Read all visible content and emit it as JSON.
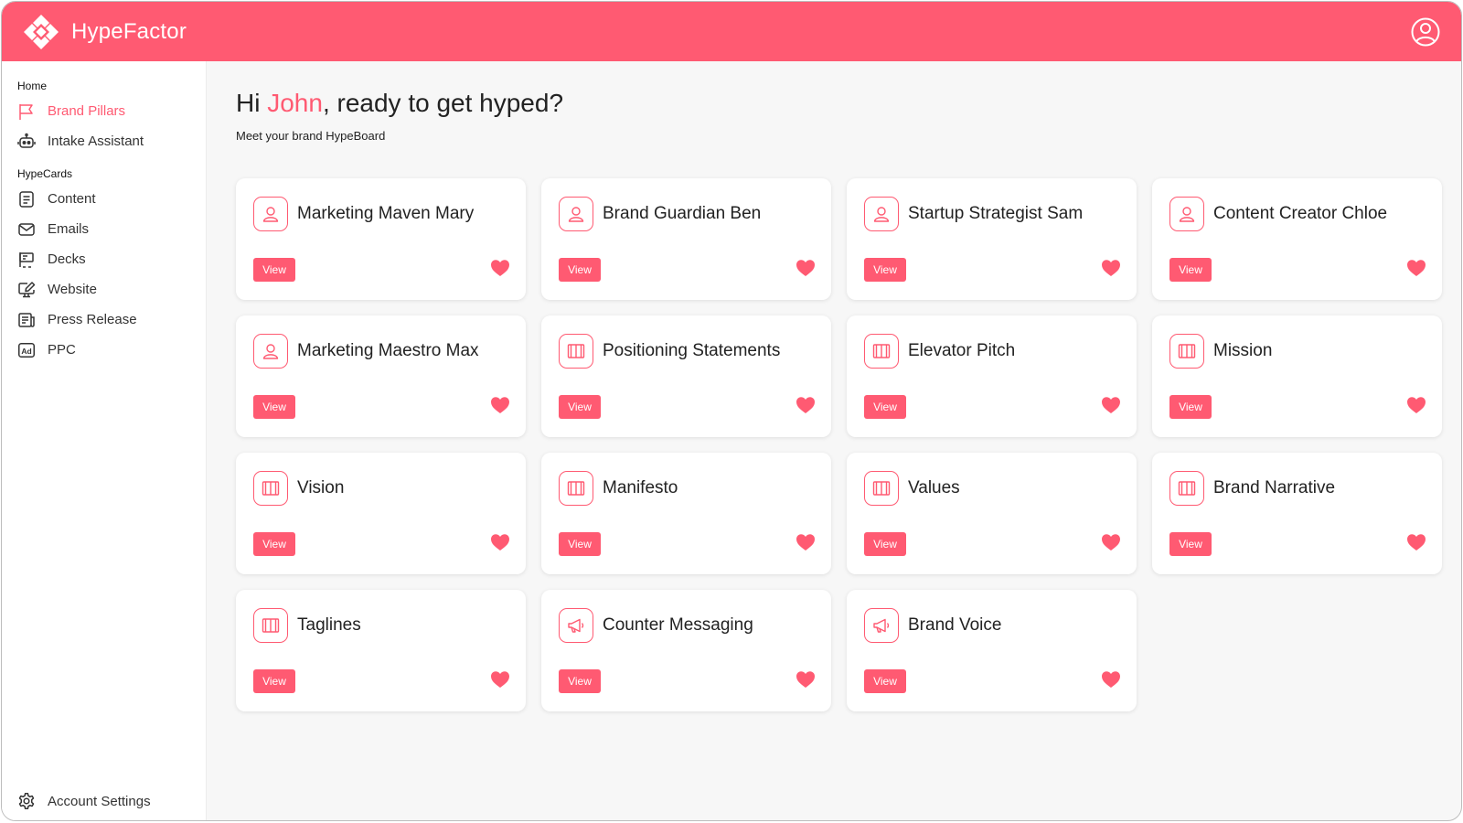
{
  "app": {
    "name": "HypeFactor"
  },
  "colors": {
    "accent": "#ff5a72",
    "background": "#f7f7f7",
    "card": "#ffffff"
  },
  "sidebar": {
    "home_section": "Home",
    "home_items": [
      {
        "label": "Brand Pillars",
        "icon": "flag-icon",
        "active": true
      },
      {
        "label": "Intake Assistant",
        "icon": "robot-icon",
        "active": false
      }
    ],
    "hypecards_section": "HypeCards",
    "hypecard_items": [
      {
        "label": "Content",
        "icon": "document-icon"
      },
      {
        "label": "Emails",
        "icon": "envelope-icon"
      },
      {
        "label": "Decks",
        "icon": "presentation-icon"
      },
      {
        "label": "Website",
        "icon": "monitor-edit-icon"
      },
      {
        "label": "Press Release",
        "icon": "newspaper-icon"
      },
      {
        "label": "PPC",
        "icon": "ad-icon"
      }
    ],
    "account_settings": "Account Settings"
  },
  "main": {
    "greeting_prefix": "Hi ",
    "user_name": "John",
    "greeting_suffix": ", ready to get hyped?",
    "subtitle": "Meet your brand HypeBoard"
  },
  "cards": [
    {
      "title": "Marketing Maven Mary",
      "icon": "user-icon",
      "button": "View"
    },
    {
      "title": "Brand Guardian Ben",
      "icon": "user-icon",
      "button": "View"
    },
    {
      "title": "Startup Strategist Sam",
      "icon": "user-icon",
      "button": "View"
    },
    {
      "title": "Content Creator Chloe",
      "icon": "user-icon",
      "button": "View"
    },
    {
      "title": "Marketing Maestro Max",
      "icon": "user-icon",
      "button": "View"
    },
    {
      "title": "Positioning Statements",
      "icon": "book-icon",
      "button": "View"
    },
    {
      "title": "Elevator Pitch",
      "icon": "book-icon",
      "button": "View"
    },
    {
      "title": "Mission",
      "icon": "book-icon",
      "button": "View"
    },
    {
      "title": "Vision",
      "icon": "book-icon",
      "button": "View"
    },
    {
      "title": "Manifesto",
      "icon": "book-icon",
      "button": "View"
    },
    {
      "title": "Values",
      "icon": "book-icon",
      "button": "View"
    },
    {
      "title": "Brand Narrative",
      "icon": "book-icon",
      "button": "View"
    },
    {
      "title": "Taglines",
      "icon": "book-icon",
      "button": "View"
    },
    {
      "title": "Counter Messaging",
      "icon": "megaphone-icon",
      "button": "View"
    },
    {
      "title": "Brand Voice",
      "icon": "megaphone-icon",
      "button": "View"
    }
  ]
}
